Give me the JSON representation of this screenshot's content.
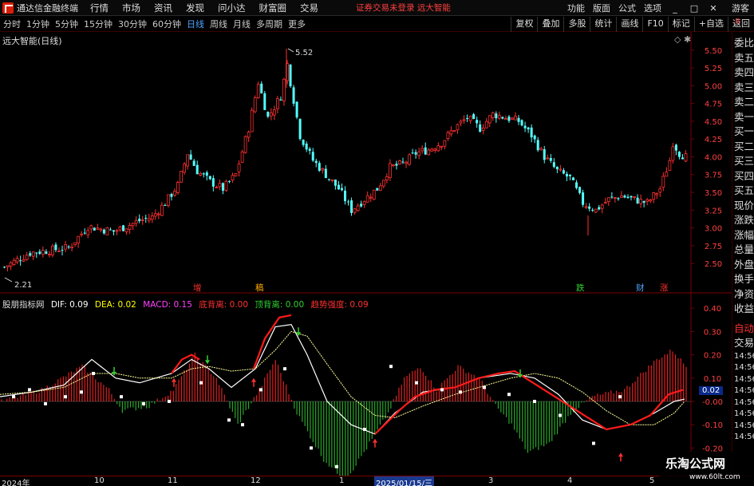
{
  "menubar": {
    "app_name": "通达信金融终端",
    "menus": [
      "行情",
      "市场",
      "资讯",
      "发现",
      "问小达",
      "财富圈",
      "交易"
    ],
    "center_note": "证券交易未登录  远大智能",
    "right_menus": [
      "功能",
      "版面",
      "公式",
      "选项"
    ],
    "user": "游客"
  },
  "toolbar": {
    "periods": [
      "分时",
      "1分钟",
      "5分钟",
      "15分钟",
      "30分钟",
      "60分钟",
      "日线",
      "周线",
      "月线",
      "多周期",
      "更多"
    ],
    "active": "日线",
    "right_tools": [
      "复权",
      "叠加",
      "多股",
      "统计",
      "画线",
      "F10",
      "标记",
      "+自选",
      "返回"
    ]
  },
  "main_chart": {
    "title": "远大智能(日线)",
    "controls": "◇ ✱",
    "high_label": "5.52",
    "low_label": "2.21",
    "yticks": [
      "5.50",
      "5.25",
      "5.00",
      "4.75",
      "4.50",
      "4.25",
      "4.00",
      "3.75",
      "3.50",
      "3.25",
      "3.00",
      "2.75",
      "2.50"
    ],
    "markers": [
      {
        "text": "增",
        "color": "#ff3030"
      },
      {
        "text": "稿",
        "color": "#ffaa00"
      },
      {
        "text": "跌",
        "color": "#30d030"
      },
      {
        "text": "财",
        "color": "#4fa3ff"
      },
      {
        "text": "涨",
        "color": "#ff3030"
      }
    ]
  },
  "sub_chart": {
    "name": "股朋指标网",
    "dif": "DIF: 0.09",
    "dea": "DEA: 0.02",
    "macd": "MACD: 0.15",
    "bottom_div": "底背离: 0.00",
    "top_div": "顶背离: 0.00",
    "trend": "趋势强度: 0.09",
    "yticks": [
      "0.40",
      "0.30",
      "0.20",
      "0.10",
      "-0.00",
      "-0.10",
      "-0.20"
    ],
    "current": "0.02",
    "colors": {
      "dif": "#ffffff",
      "dea": "#ffff00",
      "macd": "#ff40ff",
      "bottom_div": "#ff3030",
      "top_div": "#30d030",
      "trend": "#ff3030"
    }
  },
  "side_panel": {
    "top_r": "R",
    "tabs": [
      "委比",
      "卖五",
      "卖四",
      "卖三",
      "卖二",
      "卖一",
      "买一",
      "买二",
      "买三",
      "买四",
      "买五",
      "现价",
      "涨跌",
      "涨幅",
      "总量",
      "外盘",
      "换手",
      "净资",
      "收益"
    ],
    "sub_tabs": [
      "自动",
      "交易"
    ],
    "time_rows": [
      "14:56",
      "14:56",
      "14:56",
      "14:56",
      "14:56",
      "14:56",
      "14:56",
      "14:56"
    ]
  },
  "time_axis": {
    "labels": [
      "2024年",
      "10",
      "11",
      "12",
      "1",
      "2025/01/15/三",
      "3",
      "4",
      "5"
    ],
    "highlight": "2025/01/15/三"
  },
  "watermark": {
    "title": "乐淘公式网",
    "url": "www.60lt.com"
  }
}
